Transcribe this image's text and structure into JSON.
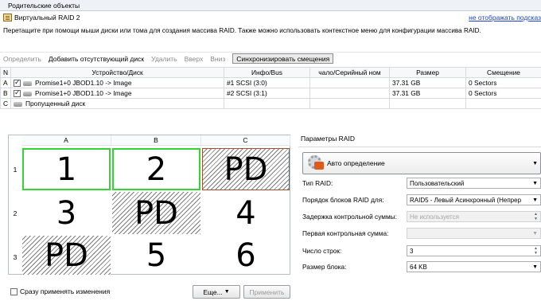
{
  "panel": {
    "title": "Родительские объекты"
  },
  "raid_header": {
    "name": "Виртуальный RAID 2",
    "hide_link": "не отображать подсказ",
    "hint": "Перетащите при помощи мыши диски или тома для создания массива RAID. Также можно использовать контекстное меню для конфигурации массива RAID."
  },
  "toolbar": {
    "define": "Определить",
    "add_missing": "Добавить отсутствующий диск",
    "delete": "Удалить",
    "up": "Вверх",
    "down": "Вниз",
    "sync_offsets": "Синхронизировать смещения"
  },
  "disk_table": {
    "columns": [
      "N",
      "Устройство/Диск",
      "Инфо/Bus",
      "чало/Серийный ном",
      "Размер",
      "Смещение"
    ],
    "rows": [
      {
        "n": "A",
        "checked": true,
        "device": "Promise1+0 JBOD1.10 -> Image",
        "info": "#1 SCSI (3:0)",
        "serial": "",
        "size": "37.31 GB",
        "offset": "0 Sectors"
      },
      {
        "n": "B",
        "checked": true,
        "device": "Promise1+0 JBOD1.10 -> Image",
        "info": "#2 SCSI (3:1)",
        "serial": "",
        "size": "37.31 GB",
        "offset": "0 Sectors"
      },
      {
        "n": "C",
        "checked": false,
        "device": "Пропущенный диск",
        "info": "",
        "serial": "",
        "size": "",
        "offset": ""
      }
    ]
  },
  "array_view": {
    "columns": [
      "A",
      "B",
      "C"
    ],
    "rows": [
      "1",
      "2",
      "3"
    ],
    "cells": [
      {
        "label": "1",
        "state": "good"
      },
      {
        "label": "2",
        "state": "good"
      },
      {
        "label": "PD",
        "state": "parity-missing"
      },
      {
        "label": "3",
        "state": "normal"
      },
      {
        "label": "PD",
        "state": "parity"
      },
      {
        "label": "4",
        "state": "normal"
      },
      {
        "label": "PD",
        "state": "parity"
      },
      {
        "label": "5",
        "state": "normal"
      },
      {
        "label": "6",
        "state": "normal"
      }
    ]
  },
  "bottom": {
    "apply_immediately": "Сразу применять изменения",
    "more_button": "Еще...",
    "apply_button": "Применить"
  },
  "raid_params": {
    "title": "Параметры RAID",
    "auto_detect": "Авто определение",
    "fields": [
      {
        "label": "Тип RAID:",
        "value": "Пользовательский",
        "kind": "dropdown",
        "enabled": true
      },
      {
        "label": "Порядок блоков RAID для:",
        "value": "RAID5 - Левый Асинхронный (Непрер",
        "kind": "dropdown",
        "enabled": true
      },
      {
        "label": "Задержка контрольной суммы:",
        "value": "Не используется",
        "kind": "spin",
        "enabled": false
      },
      {
        "label": "Первая контрольная сумма:",
        "value": "",
        "kind": "dropdown",
        "enabled": false
      },
      {
        "label": "Число строк:",
        "value": "3",
        "kind": "spin",
        "enabled": true
      },
      {
        "label": "Размер блока:",
        "value": "64 KB",
        "kind": "dropdown",
        "enabled": true
      }
    ]
  }
}
